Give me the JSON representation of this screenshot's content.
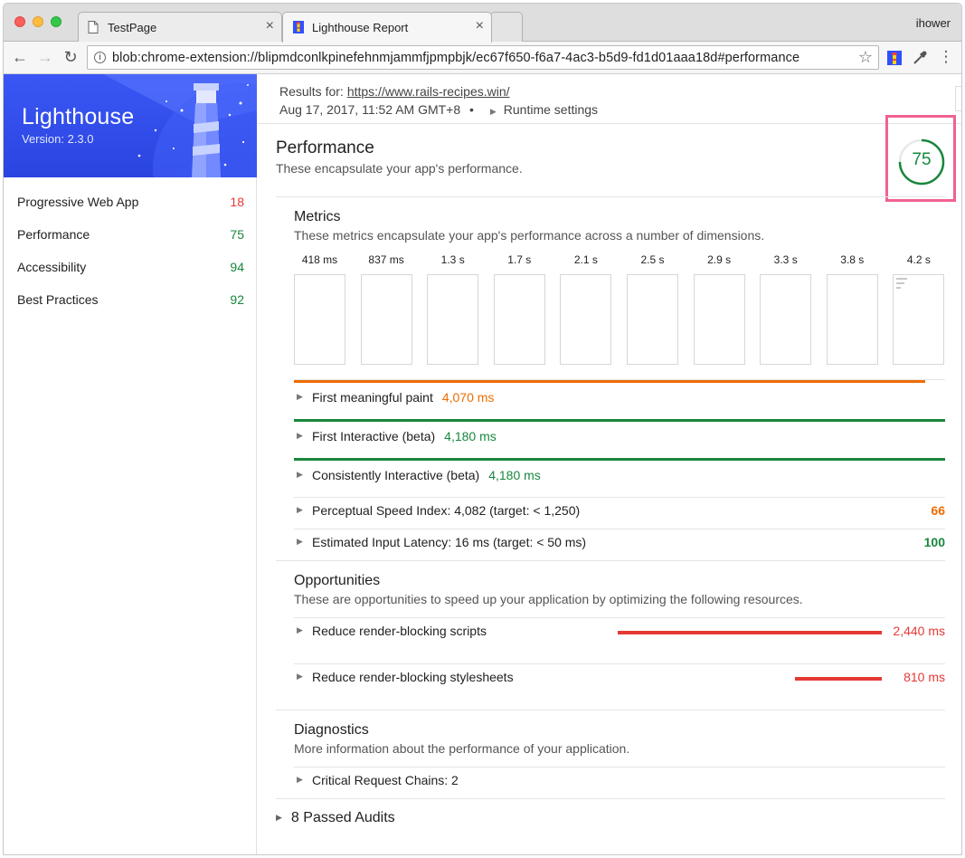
{
  "browser": {
    "tabs": [
      {
        "title": "TestPage",
        "close": "×"
      },
      {
        "title": "Lighthouse Report",
        "close": "×"
      }
    ],
    "user": "ihower",
    "url": "blob:chrome-extension://blipmdconlkpinefehnmjammfjpmpbjk/ec67f650-f6a7-4ac3-b5d9-fd1d01aaa18d#performance",
    "back": "←",
    "forward": "→",
    "reload": "↻",
    "star": "☆",
    "menu": "⋮"
  },
  "sidebar": {
    "title": "Lighthouse",
    "version": "Version: 2.3.0",
    "items": [
      {
        "label": "Progressive Web App",
        "score": "18",
        "status": "fail"
      },
      {
        "label": "Performance",
        "score": "75",
        "status": "pass"
      },
      {
        "label": "Accessibility",
        "score": "94",
        "status": "pass"
      },
      {
        "label": "Best Practices",
        "score": "92",
        "status": "pass"
      }
    ]
  },
  "header": {
    "results_for": "Results for:",
    "url": "https://www.rails-recipes.win/",
    "date": "Aug 17, 2017, 11:52 AM GMT+8",
    "bullet": "•",
    "runtime": "Runtime settings"
  },
  "performance": {
    "title": "Performance",
    "description": "These encapsulate your app's performance.",
    "score": "75",
    "score_fraction": 0.75,
    "score_color": "#18873d"
  },
  "metrics": {
    "title": "Metrics",
    "description": "These metrics encapsulate your app's performance across a number of dimensions.",
    "filmstrip": [
      "418 ms",
      "837 ms",
      "1.3 s",
      "1.7 s",
      "2.1 s",
      "2.5 s",
      "2.9 s",
      "3.3 s",
      "3.8 s",
      "4.2 s"
    ],
    "timeline": [
      {
        "label": "First meaningful paint",
        "value": "4,070 ms",
        "status": "avg",
        "color": "#ef6c00",
        "fraction": 0.969
      },
      {
        "label": "First Interactive (beta)",
        "value": "4,180 ms",
        "status": "pass",
        "color": "#18873d",
        "fraction": 1.0
      },
      {
        "label": "Consistently Interactive (beta)",
        "value": "4,180 ms",
        "status": "pass",
        "color": "#18873d",
        "fraction": 1.0
      }
    ],
    "scored": [
      {
        "label": "Perceptual Speed Index: 4,082 (target: < 1,250)",
        "score": "66",
        "status": "avg"
      },
      {
        "label": "Estimated Input Latency: 16 ms (target: < 50 ms)",
        "score": "100",
        "status": "pass"
      }
    ]
  },
  "opportunities": {
    "title": "Opportunities",
    "description": "These are opportunities to speed up your application by optimizing the following resources.",
    "items": [
      {
        "label": "Reduce render-blocking scripts",
        "value": "2,440 ms",
        "fraction": 1.0
      },
      {
        "label": "Reduce render-blocking stylesheets",
        "value": "810 ms",
        "fraction": 0.33
      }
    ]
  },
  "diagnostics": {
    "title": "Diagnostics",
    "description": "More information about the performance of your application.",
    "items": [
      {
        "label": "Critical Request Chains: 2"
      }
    ]
  },
  "passed_audits": "8 Passed Audits"
}
